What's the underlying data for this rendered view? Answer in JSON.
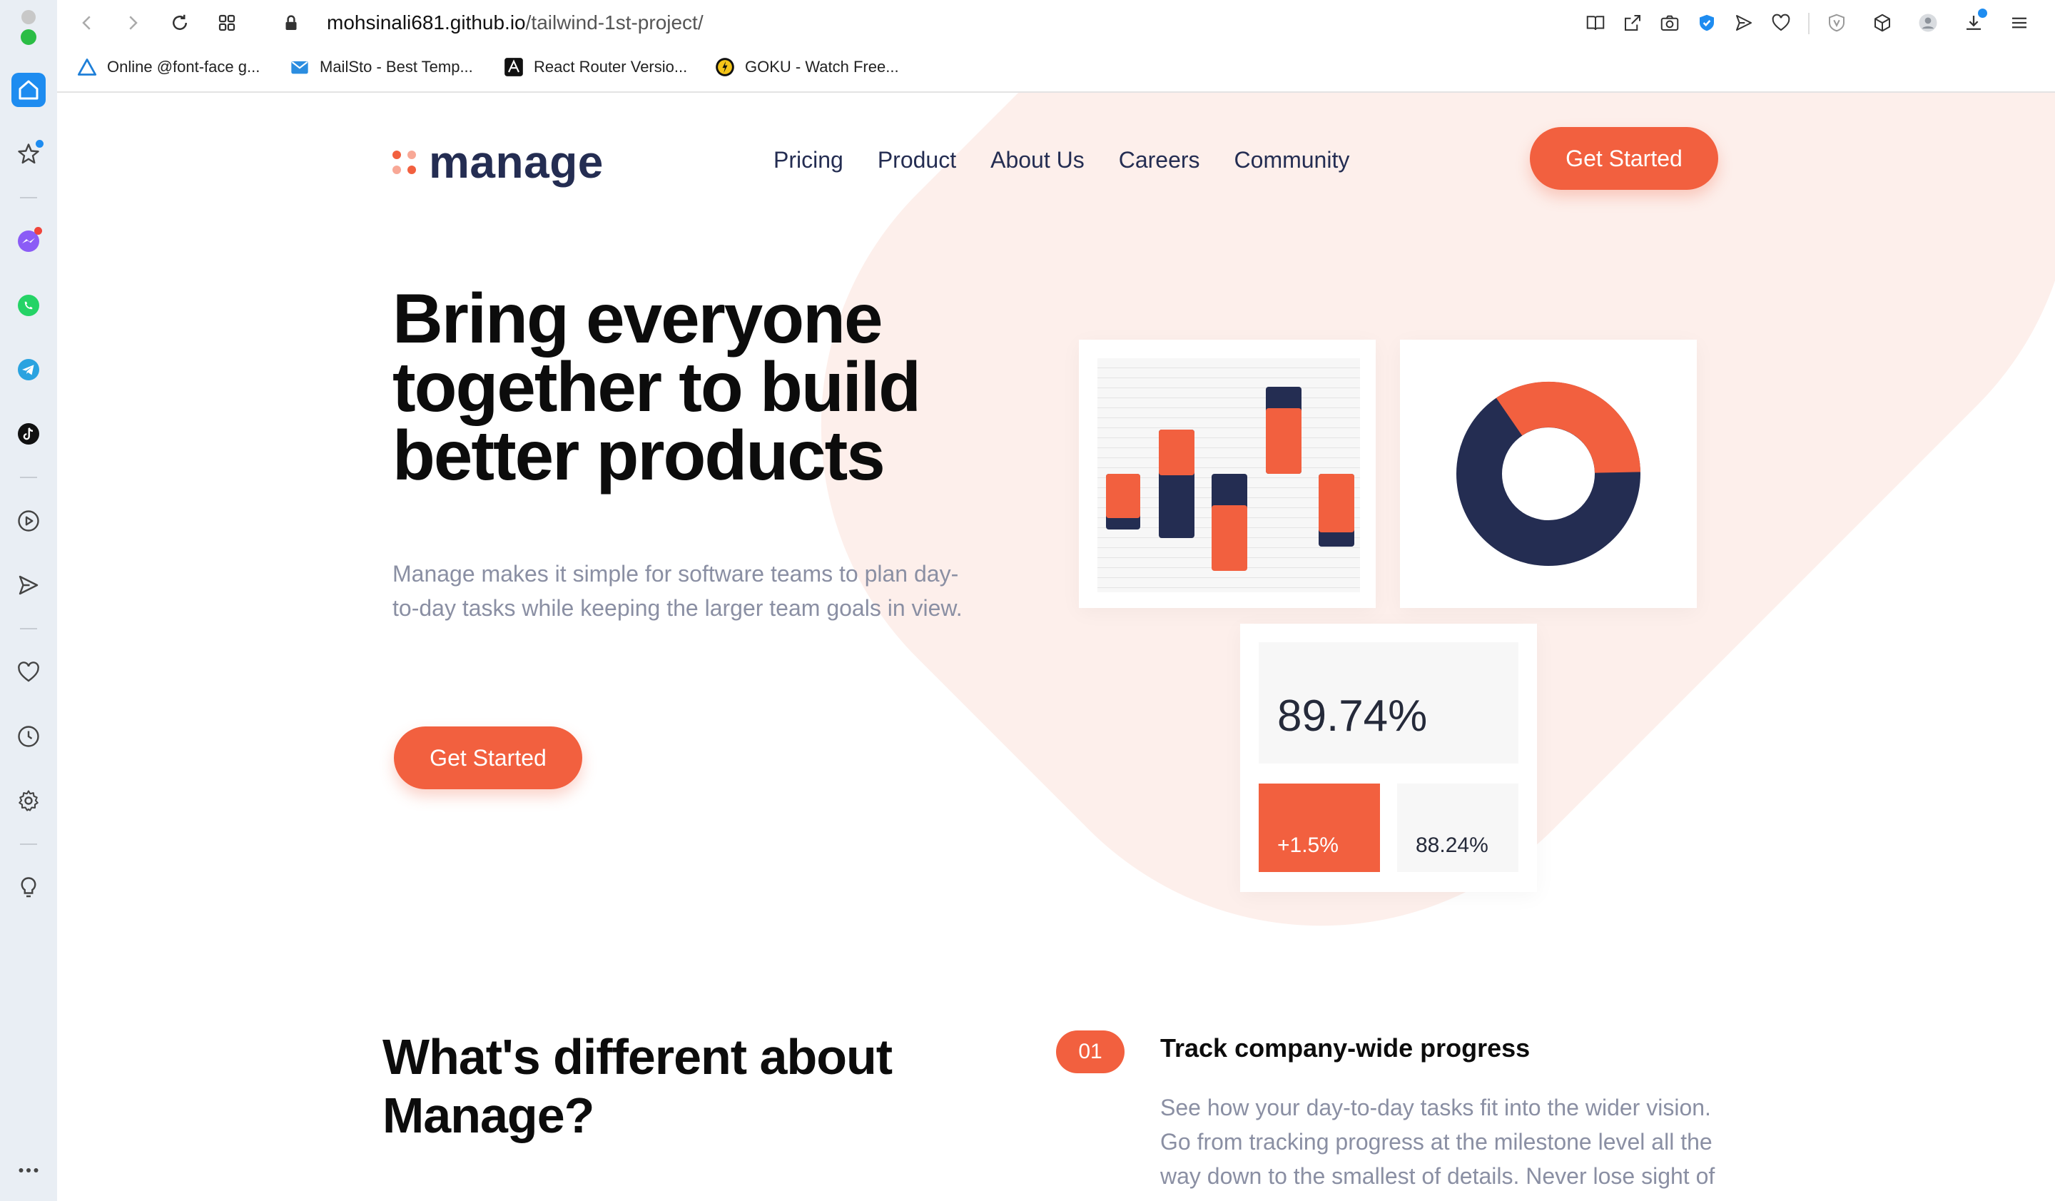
{
  "browser": {
    "url_host": "mohsinali681.github.io",
    "url_path": "/tailwind-1st-project/",
    "bookmarks": [
      {
        "label": "Online @font-face g...",
        "icon": "triangle-icon"
      },
      {
        "label": "MailSto - Best Temp...",
        "icon": "mail-icon"
      },
      {
        "label": "React Router Versio...",
        "icon": "react-router-icon"
      },
      {
        "label": "GOKU - Watch Free...",
        "icon": "goku-icon"
      }
    ]
  },
  "header": {
    "logo_text": "manage",
    "nav": [
      "Pricing",
      "Product",
      "About Us",
      "Careers",
      "Community"
    ],
    "cta_label": "Get Started"
  },
  "hero": {
    "title": "Bring everyone together to build better products",
    "description": "Manage makes it simple for software teams to plan day-to-day tasks while keeping the larger team goals in view.",
    "cta_label": "Get Started"
  },
  "stats": {
    "main_value": "89.74%",
    "change_value": "+1.5%",
    "secondary_value": "88.24%"
  },
  "features": {
    "heading": "What's different about Manage?",
    "items": [
      {
        "number": "01",
        "title": "Track company-wide progress",
        "description": "See how your day-to-day tasks fit into the wider vision. Go from tracking progress at the milestone level all the way down to the smallest of details. Never lose sight of"
      }
    ]
  },
  "colors": {
    "accent": "#f2603f",
    "navy": "#242d52",
    "muted_text": "#8a8fa3",
    "blob": "#fdefeb"
  }
}
